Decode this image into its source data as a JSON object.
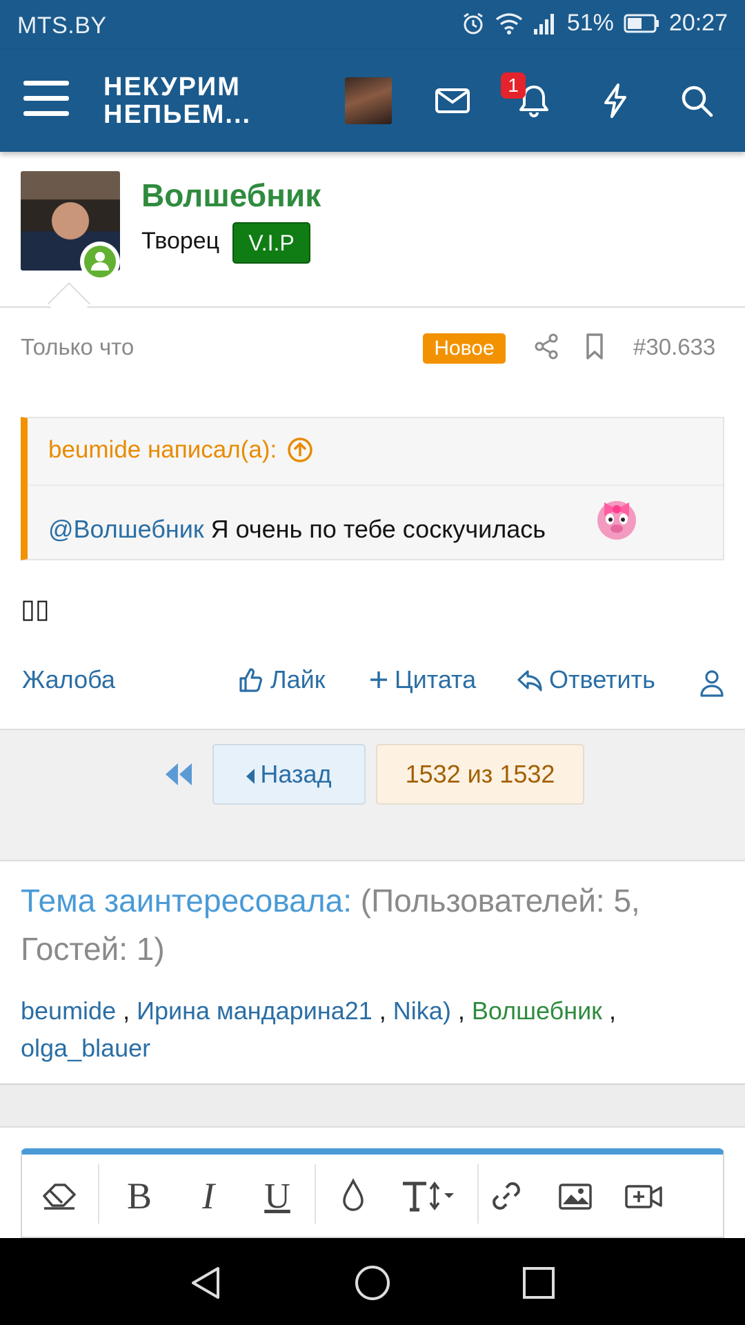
{
  "status": {
    "carrier": "MTS.BY",
    "battery": "51%",
    "time": "20:27"
  },
  "header": {
    "logo_line1": "НЕКУРИМ",
    "logo_line2": "НЕПЬЕМ...",
    "notification_count": "1",
    "icons": [
      "menu-icon",
      "user-avatar",
      "mail-icon",
      "bell-icon",
      "lightning-icon",
      "search-icon"
    ]
  },
  "author": {
    "name": "Волшебник",
    "title": "Творец",
    "badge": "V.I.P"
  },
  "meta": {
    "time": "Только что",
    "new_label": "Новое",
    "post_number": "#30.633"
  },
  "quote": {
    "header": "beumide написал(а):",
    "mention": "@Волшебник",
    "text": " Я очень по тебе соскучилась"
  },
  "post": {
    "text": "▯▯"
  },
  "actions": {
    "report": "Жалоба",
    "like": "Лайк",
    "quote": "Цитата",
    "reply": "Ответить"
  },
  "pager": {
    "back": "Назад",
    "page": "1532 из 1532"
  },
  "interested": {
    "title": "Тема заинтересовала:",
    "counts": "(Пользователей: 5, Гостей: 1)",
    "users": [
      "beumide",
      "Ирина мандарина21",
      "Nika)",
      "Волшебник",
      "olga_blauer"
    ]
  },
  "colors": {
    "header_bg": "#1b5a8c",
    "link": "#2a6ea5",
    "accent_orange": "#f39200",
    "vip_green": "#0f7d14",
    "author_green": "#2f8b3e"
  }
}
